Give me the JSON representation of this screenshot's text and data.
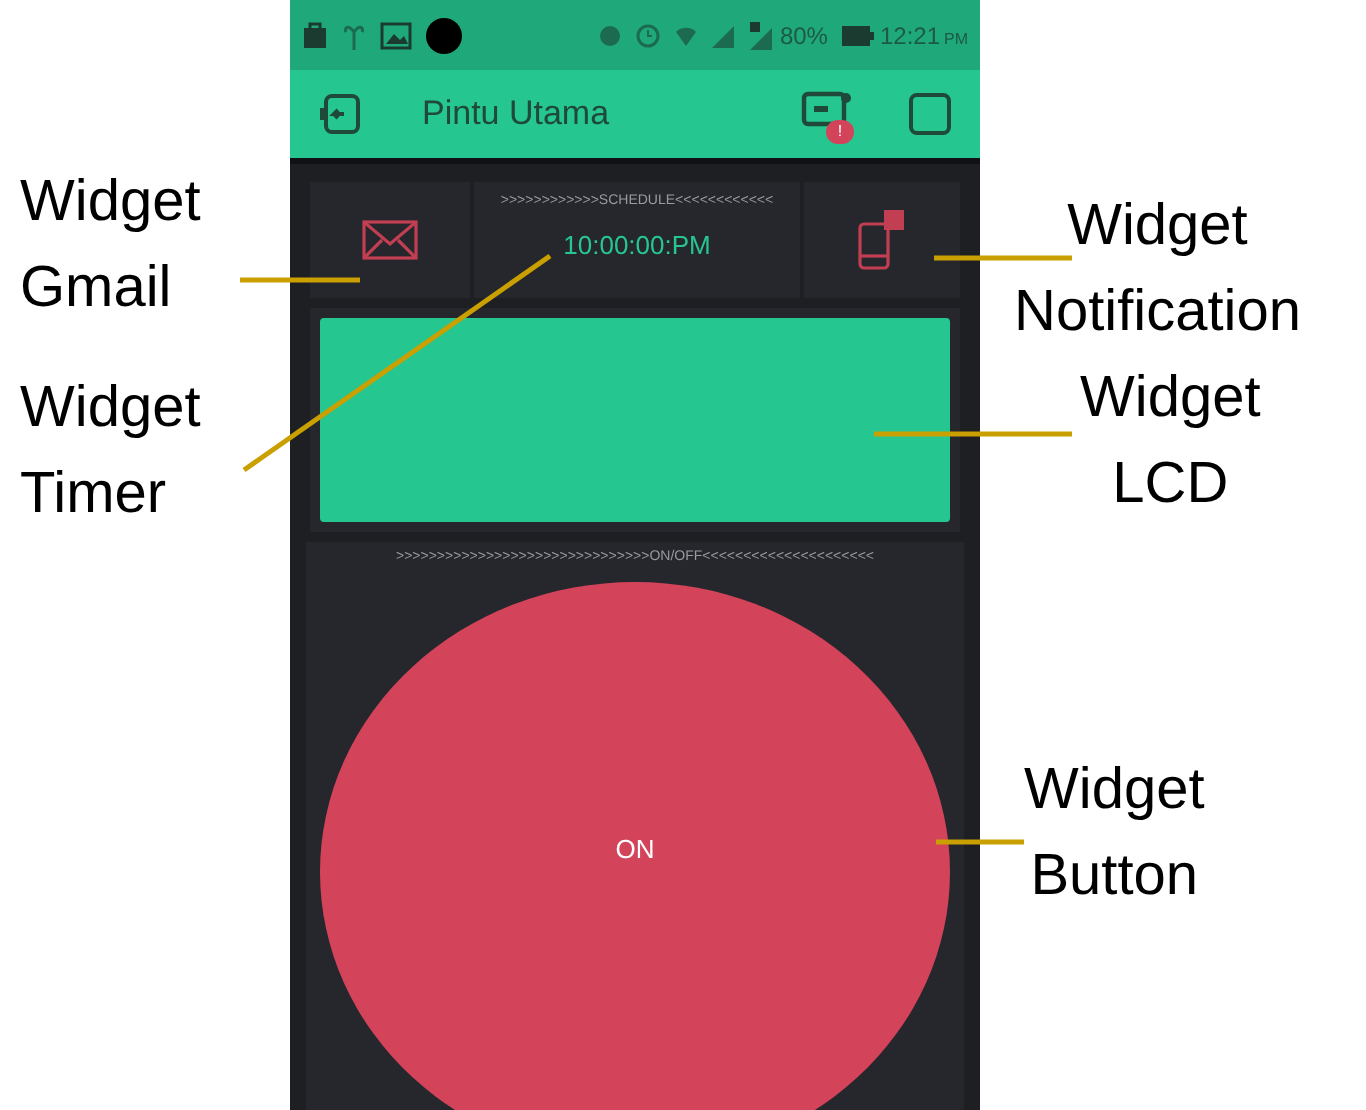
{
  "status_bar": {
    "battery": "80%",
    "time": "12:21",
    "time_suffix": "PM"
  },
  "app_bar": {
    "title": "Pintu Utama",
    "badge": "!"
  },
  "widgets": {
    "schedule_label": ">>>>>>>>>>>>SCHEDULE<<<<<<<<<<<<",
    "timer_value": "10:00:00:PM",
    "button_label": ">>>>>>>>>>>>>>>>>>>>>>>>>>>>>>>ON/OFF<<<<<<<<<<<<<<<<<<<<<",
    "button_text": "ON"
  },
  "annotations": [
    {
      "text": "Widget\nGmail",
      "kind": "left"
    },
    {
      "text": "Widget\nTimer",
      "kind": "left"
    },
    {
      "text": "Widget\nNotification",
      "kind": "right"
    },
    {
      "text": "Widget\nLCD",
      "kind": "right"
    },
    {
      "text": "Widget\nButton",
      "kind": "right"
    }
  ]
}
